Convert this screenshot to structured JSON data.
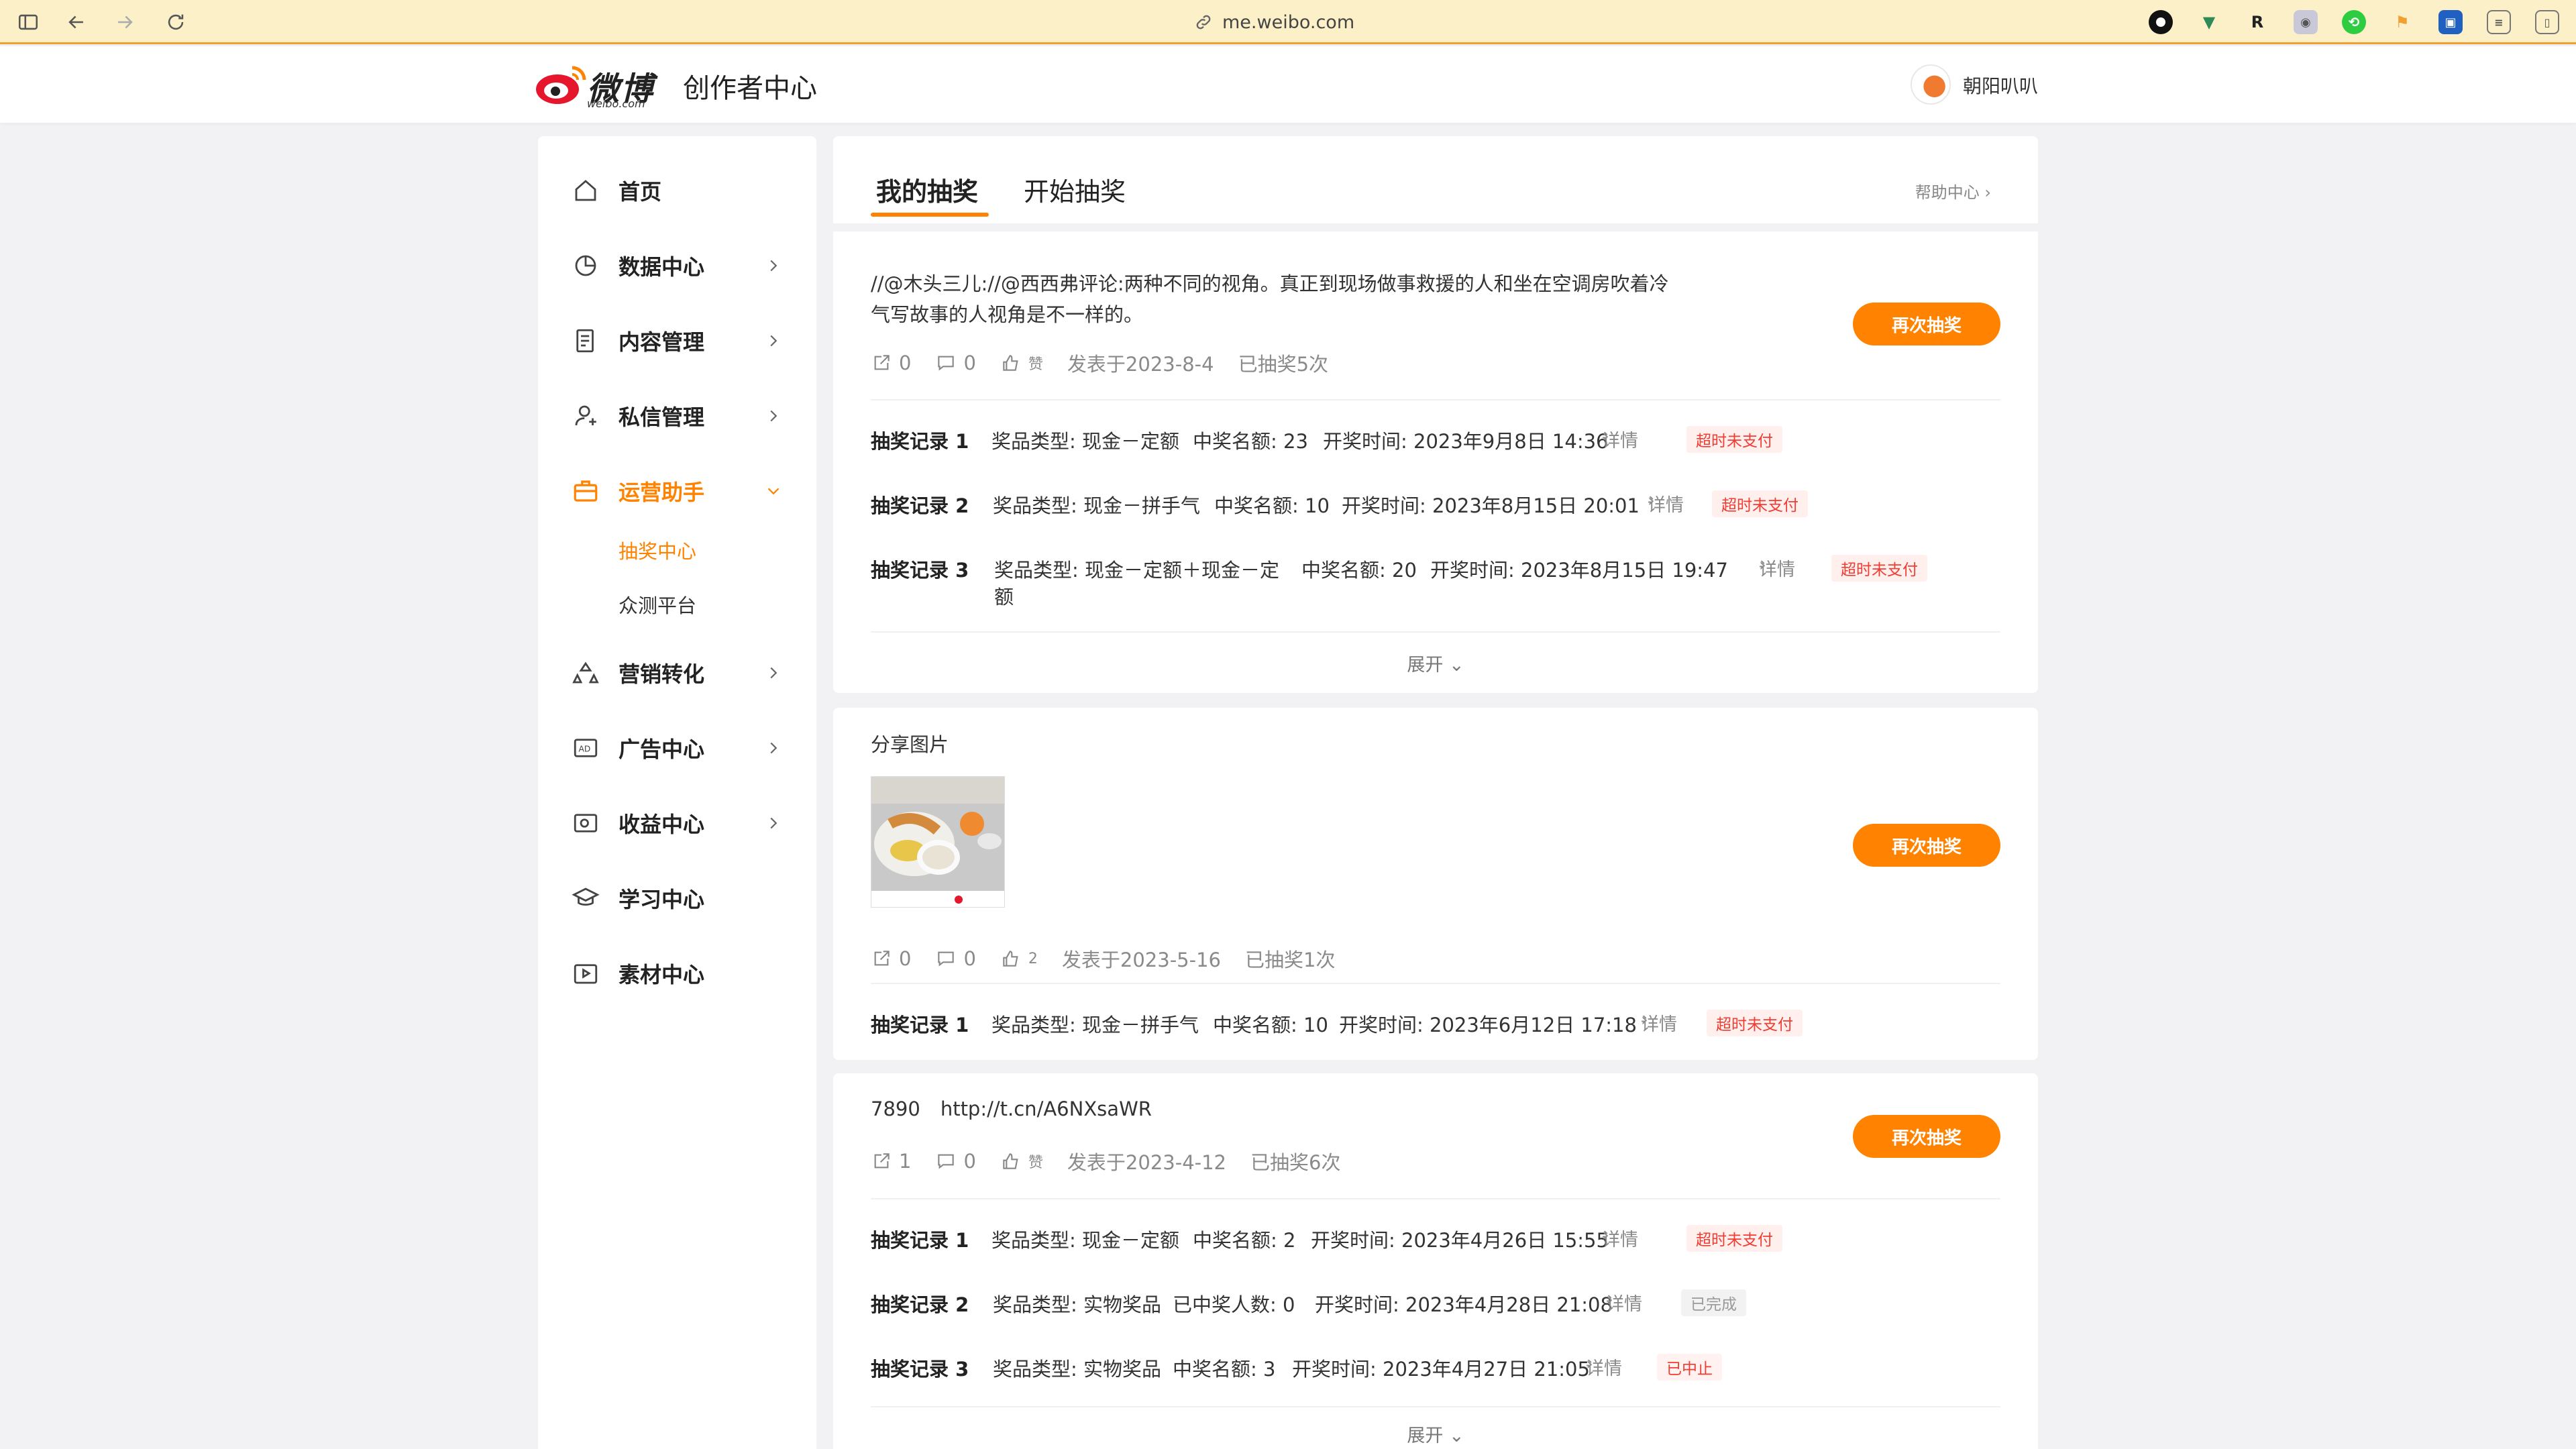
{
  "browser": {
    "url": "me.weibo.com"
  },
  "header": {
    "logo_text": "微博",
    "logo_sub": "weibo.com",
    "title": "创作者中心",
    "username": "朝阳叭叭"
  },
  "sidebar": {
    "items": [
      {
        "label": "首页"
      },
      {
        "label": "数据中心"
      },
      {
        "label": "内容管理"
      },
      {
        "label": "私信管理"
      },
      {
        "label": "运营助手"
      },
      {
        "label": "营销转化"
      },
      {
        "label": "广告中心"
      },
      {
        "label": "收益中心"
      },
      {
        "label": "学习中心"
      },
      {
        "label": "素材中心"
      }
    ],
    "sub_items": [
      {
        "label": "抽奖中心"
      },
      {
        "label": "众测平台"
      }
    ]
  },
  "tabs": {
    "my_lottery": "我的抽奖",
    "start_lottery": "开始抽奖",
    "help": "帮助中心"
  },
  "common": {
    "redraw": "再次抽奖",
    "expand": "展开",
    "detail": "详情",
    "like_word": "赞"
  },
  "posts": [
    {
      "text_line1": "//@木头三儿://@西西弗评论:两种不同的视角。真正到现场做事救援的人和坐在空调房吹着冷",
      "text_line2": "气写故事的人视角是不一样的。",
      "reposts": "0",
      "comments": "0",
      "published": "发表于2023-8-4",
      "drawn": "已抽奖5次",
      "records": [
        {
          "label": "抽奖记录 1",
          "type": "奖品类型: 现金－定额",
          "count": "中奖名额: 23",
          "time": "开奖时间: 2023年9月8日 14:36",
          "status": "超时未支付"
        },
        {
          "label": "抽奖记录 2",
          "type": "奖品类型: 现金－拼手气",
          "count": "中奖名额: 10",
          "time": "开奖时间: 2023年8月15日 20:01",
          "status": "超时未支付"
        },
        {
          "label": "抽奖记录 3",
          "type": "奖品类型: 现金－定额＋现金－定",
          "type2": "额",
          "count": "中奖名额: 20",
          "time": "开奖时间: 2023年8月15日 19:47",
          "status": "超时未支付"
        }
      ]
    },
    {
      "text": "分享图片",
      "reposts": "0",
      "comments": "0",
      "likes": "2",
      "published": "发表于2023-5-16",
      "drawn": "已抽奖1次",
      "records": [
        {
          "label": "抽奖记录 1",
          "type": "奖品类型: 现金－拼手气",
          "count": "中奖名额: 10",
          "time": "开奖时间: 2023年6月12日 17:18",
          "status": "超时未支付"
        }
      ]
    },
    {
      "text": "7890",
      "link": "http://t.cn/A6NXsaWR",
      "reposts": "1",
      "comments": "0",
      "published": "发表于2023-4-12",
      "drawn": "已抽奖6次",
      "records": [
        {
          "label": "抽奖记录 1",
          "type": "奖品类型: 现金－定额",
          "count": "中奖名额: 2",
          "time": "开奖时间: 2023年4月26日 15:55",
          "status": "超时未支付"
        },
        {
          "label": "抽奖记录 2",
          "type": "奖品类型: 实物奖品",
          "count": "已中奖人数: 0",
          "time": "开奖时间: 2023年4月28日 21:08",
          "status": "已完成"
        },
        {
          "label": "抽奖记录 3",
          "type": "奖品类型: 实物奖品",
          "count": "中奖名额: 3",
          "time": "开奖时间: 2023年4月27日 21:05",
          "status": "已中止"
        }
      ]
    }
  ],
  "colors": {
    "accent": "#ff8200",
    "status_red": "#f03c32",
    "browser_bar": "#fbf0c8"
  }
}
